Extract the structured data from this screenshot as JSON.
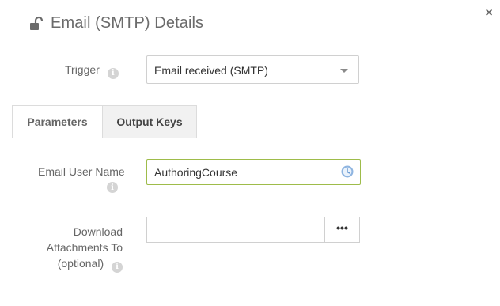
{
  "dialog": {
    "title": "Email (SMTP) Details",
    "title_icon": "unlock-icon",
    "close_glyph": "×"
  },
  "trigger": {
    "label": "Trigger",
    "value": "Email received (SMTP)"
  },
  "tabs": [
    {
      "label": "Parameters",
      "active": true
    },
    {
      "label": "Output Keys",
      "active": false
    }
  ],
  "email_user_name": {
    "label": "Email User Name",
    "value": "AuthoringCourse",
    "icon": "clock-icon"
  },
  "download_attachments": {
    "label_line1": "Download",
    "label_line2": "Attachments To",
    "label_line3": "(optional)",
    "value": "",
    "browse_label": "•••"
  },
  "colors": {
    "focus_border": "#9ebc4a",
    "clock_icon": "#8fb5e0"
  }
}
